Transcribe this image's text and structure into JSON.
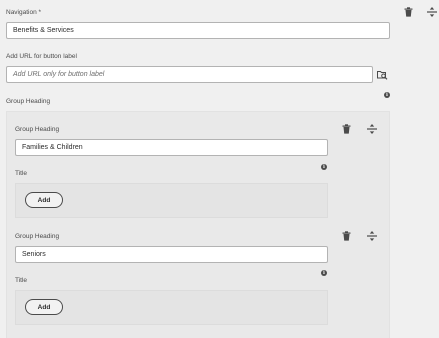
{
  "navigation": {
    "label": "Navigation *",
    "value": "Benefits & Services"
  },
  "url_field": {
    "label": "Add URL for button label",
    "placeholder": "Add URL only for button label"
  },
  "group_heading_section": {
    "label": "Group Heading"
  },
  "groups": [
    {
      "heading_label": "Group Heading",
      "heading_value": "Families & Children",
      "title_label": "Title",
      "add_label": "Add"
    },
    {
      "heading_label": "Group Heading",
      "heading_value": "Seniors",
      "title_label": "Title",
      "add_label": "Add"
    }
  ],
  "icons": {
    "delete": "trash-icon",
    "reorder": "drag-handle-icon",
    "info": "info-icon",
    "browse": "path-browser-icon"
  }
}
